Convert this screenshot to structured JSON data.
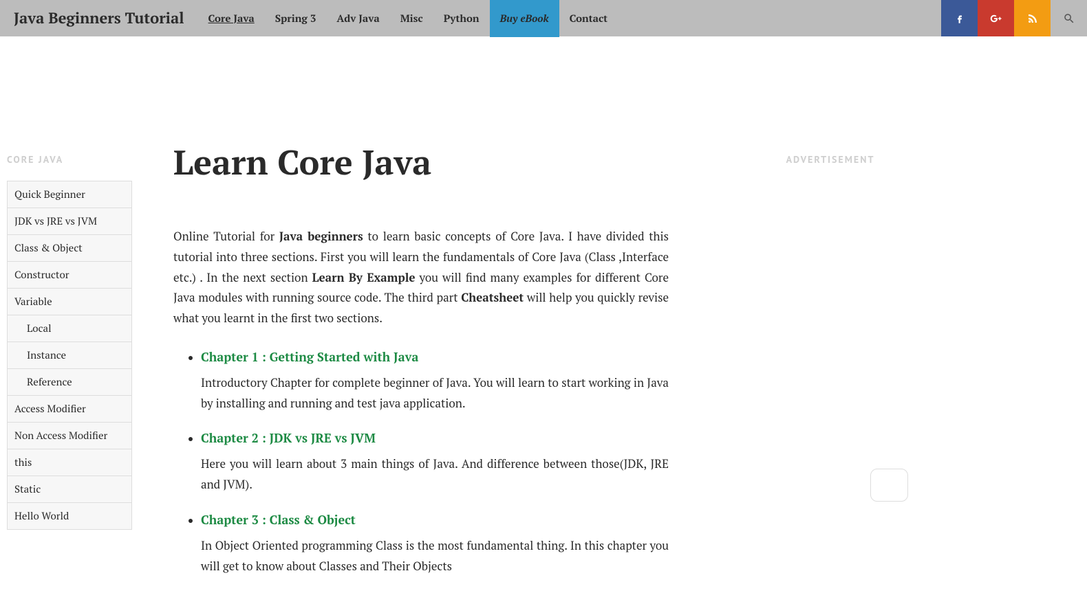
{
  "header": {
    "site_title": "Java Beginners Tutorial",
    "nav": [
      {
        "label": "Core Java",
        "active": true,
        "highlight": false
      },
      {
        "label": "Spring 3",
        "active": false,
        "highlight": false
      },
      {
        "label": "Adv Java",
        "active": false,
        "highlight": false
      },
      {
        "label": "Misc",
        "active": false,
        "highlight": false
      },
      {
        "label": "Python",
        "active": false,
        "highlight": false
      },
      {
        "label": "Buy eBook",
        "active": false,
        "highlight": true
      },
      {
        "label": "Contact",
        "active": false,
        "highlight": false
      }
    ],
    "social": {
      "facebook": "facebook-icon",
      "googleplus": "googleplus-icon",
      "rss": "rss-icon"
    },
    "search": "search-icon"
  },
  "sidebar": {
    "title": "CORE JAVA",
    "items": [
      {
        "label": "Quick Beginner",
        "sub": false
      },
      {
        "label": "JDK vs JRE vs JVM",
        "sub": false
      },
      {
        "label": "Class & Object",
        "sub": false
      },
      {
        "label": "Constructor",
        "sub": false
      },
      {
        "label": "Variable",
        "sub": false
      },
      {
        "label": "Local",
        "sub": true
      },
      {
        "label": "Instance",
        "sub": true
      },
      {
        "label": "Reference",
        "sub": true
      },
      {
        "label": "Access Modifier",
        "sub": false
      },
      {
        "label": "Non Access Modifier",
        "sub": false
      },
      {
        "label": "this",
        "sub": false
      },
      {
        "label": "Static",
        "sub": false
      },
      {
        "label": "Hello World",
        "sub": false
      }
    ]
  },
  "main": {
    "title": "Learn Core Java",
    "intro_parts": {
      "p1": "Online Tutorial for ",
      "b1": "Java beginners",
      "p2": " to learn basic concepts of Core Java. I have divided this tutorial into three sections. First you will learn the fundamentals of Core Java (Class ,Interface etc.) . In the next section ",
      "b2": "Learn By Example",
      "p3": " you will find many examples for different Core Java modules with running source code. The third part ",
      "b3": "Cheatsheet",
      "p4": " will help you quickly revise what you learnt in the first two sections."
    },
    "chapters": [
      {
        "title": "Chapter 1 : Getting Started with Java",
        "desc": "Introductory Chapter for complete beginner of Java. You will learn to start working in Java by installing and running and test java application."
      },
      {
        "title": "Chapter 2 : JDK vs JRE vs JVM",
        "desc": "Here you will learn about 3 main things of Java. And difference between those(JDK, JRE and JVM)."
      },
      {
        "title": "Chapter 3 : Class & Object",
        "desc": "In Object Oriented programming Class is the most fundamental thing. In this chapter you will get to know about Classes and Their Objects"
      }
    ]
  },
  "right": {
    "ad_label": "ADVERTISEMENT"
  }
}
